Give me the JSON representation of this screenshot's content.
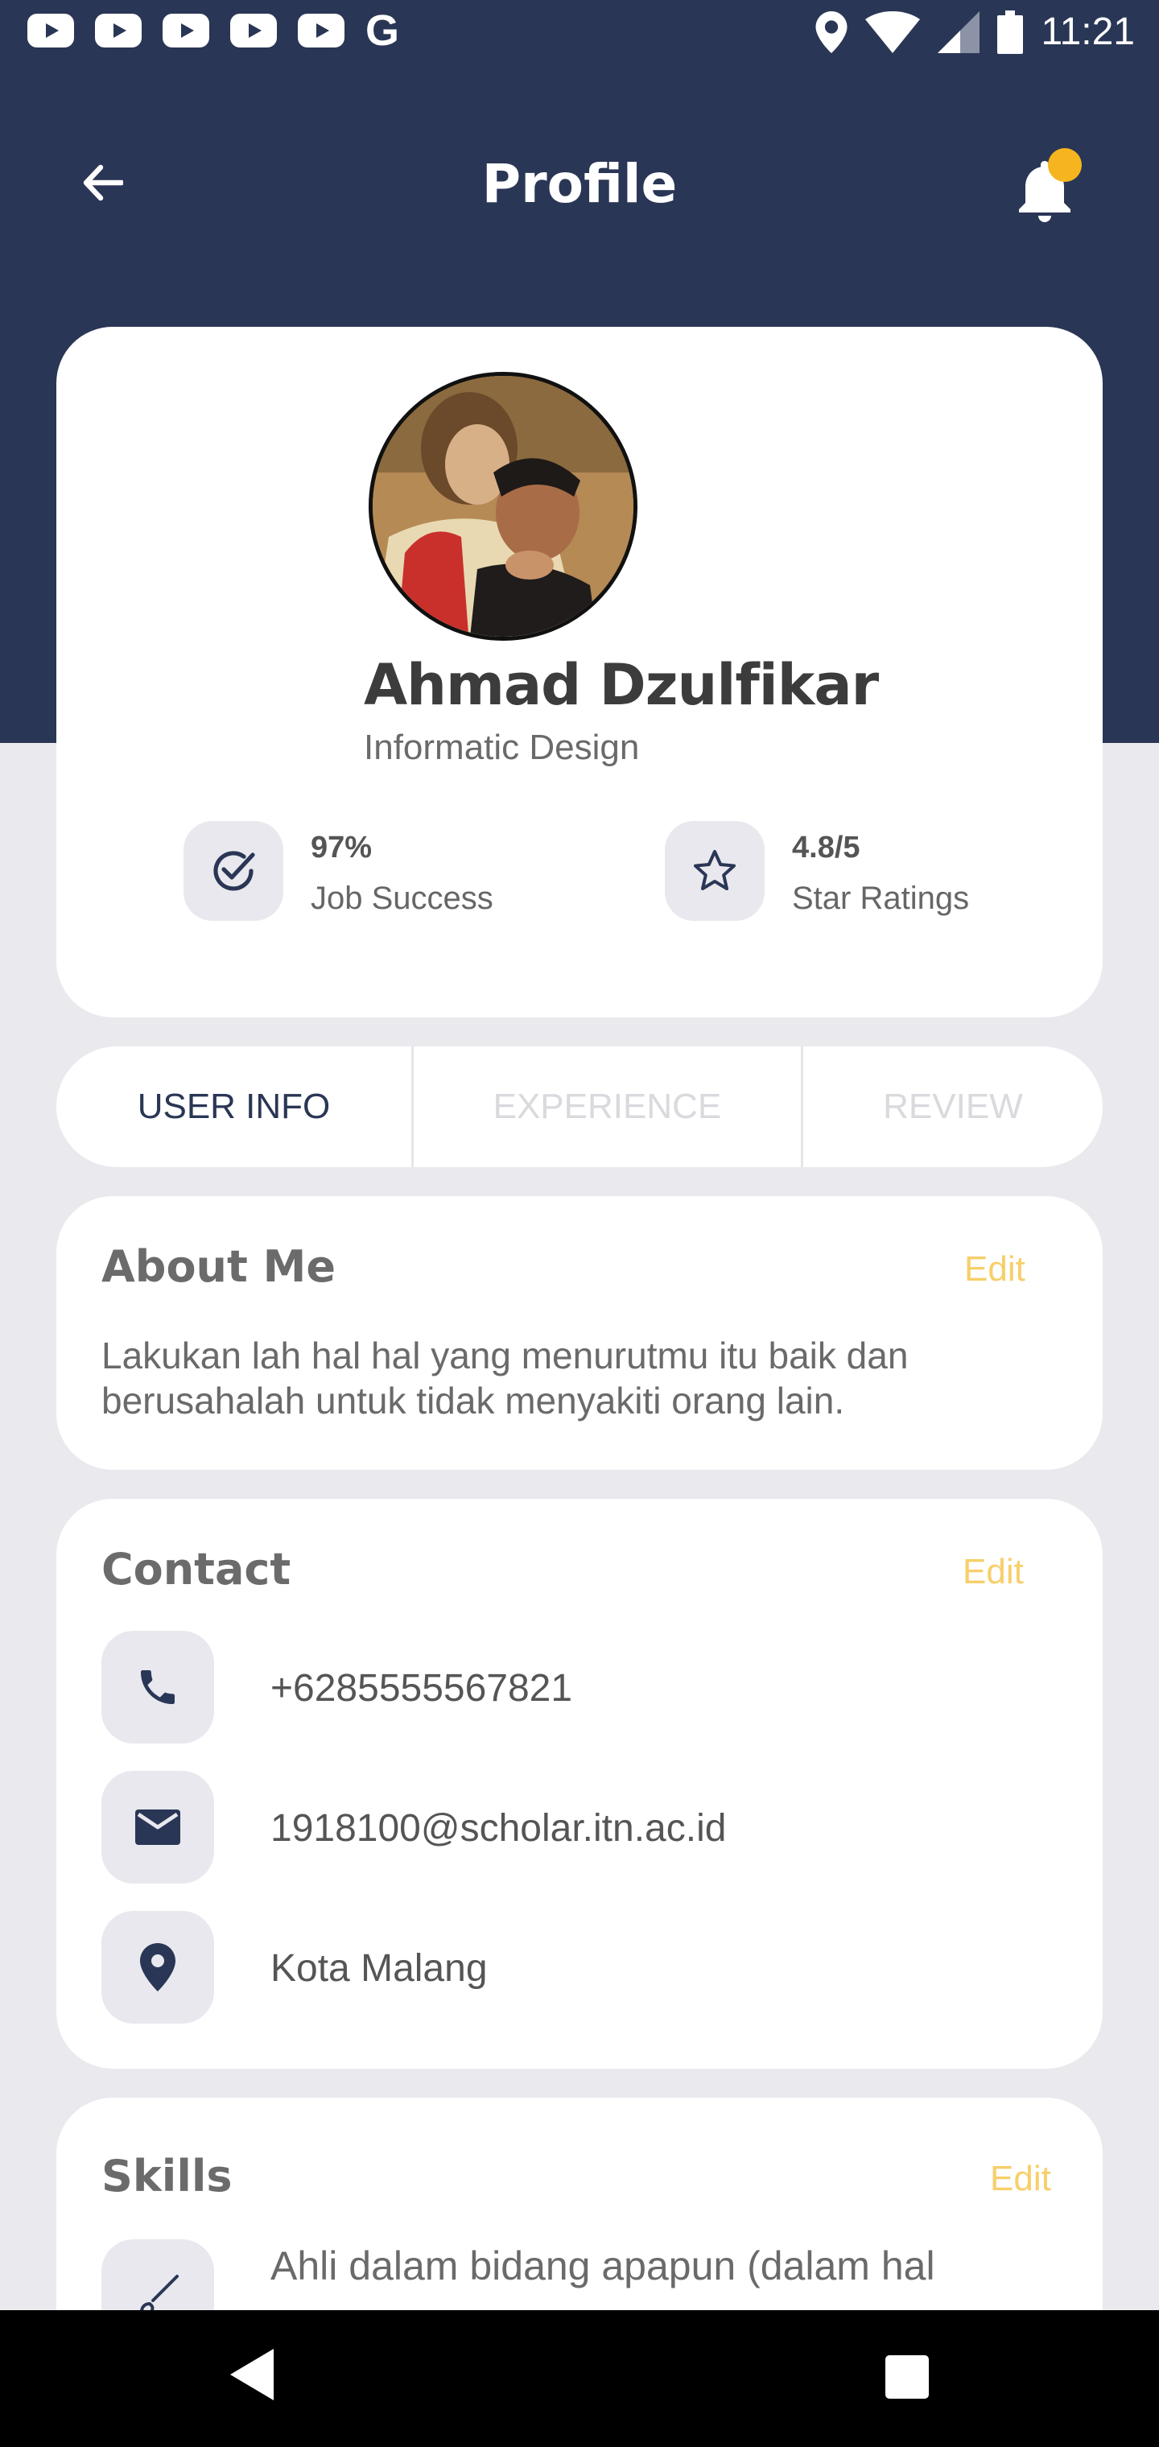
{
  "status_bar": {
    "time": "11:21",
    "notification_icons": [
      "youtube-icon",
      "youtube-icon",
      "youtube-icon",
      "youtube-icon",
      "youtube-icon",
      "google-icon"
    ],
    "google_letter": "G"
  },
  "app_bar": {
    "title": "Profile",
    "back_icon": "arrow-left-icon",
    "bell_icon": "bell-icon",
    "has_notification": true
  },
  "profile": {
    "name": "Ahmad Dzulfikar",
    "role": "Informatic Design",
    "stats": [
      {
        "icon": "check-circle-icon",
        "value": "97%",
        "label": "Job Success"
      },
      {
        "icon": "star-icon",
        "value": "4.8/5",
        "label": "Star Ratings"
      }
    ]
  },
  "tabs": [
    {
      "label": "USER INFO",
      "active": true
    },
    {
      "label": "EXPERIENCE",
      "active": false
    },
    {
      "label": "REVIEW",
      "active": false
    }
  ],
  "about": {
    "title": "About Me",
    "edit_label": "Edit",
    "text": "Lakukan lah hal hal yang menurutmu itu baik dan berusahalah untuk tidak menyakiti orang lain."
  },
  "contact": {
    "title": "Contact",
    "edit_label": "Edit",
    "items": [
      {
        "icon": "phone-icon",
        "value": "+6285555567821"
      },
      {
        "icon": "mail-icon",
        "value": "1918100@scholar.itn.ac.id"
      },
      {
        "icon": "location-pin-icon",
        "value": "Kota Malang"
      }
    ]
  },
  "skills": {
    "title": "Skills",
    "edit_label": "Edit",
    "items": [
      {
        "icon": "brush-icon",
        "value": "Ahli dalam bidang apapun (dalam hal"
      }
    ]
  },
  "colors": {
    "header": "#2a3655",
    "accent": "#f6b51e",
    "edit": "#f7cf6a",
    "background": "#e9e9ee"
  }
}
